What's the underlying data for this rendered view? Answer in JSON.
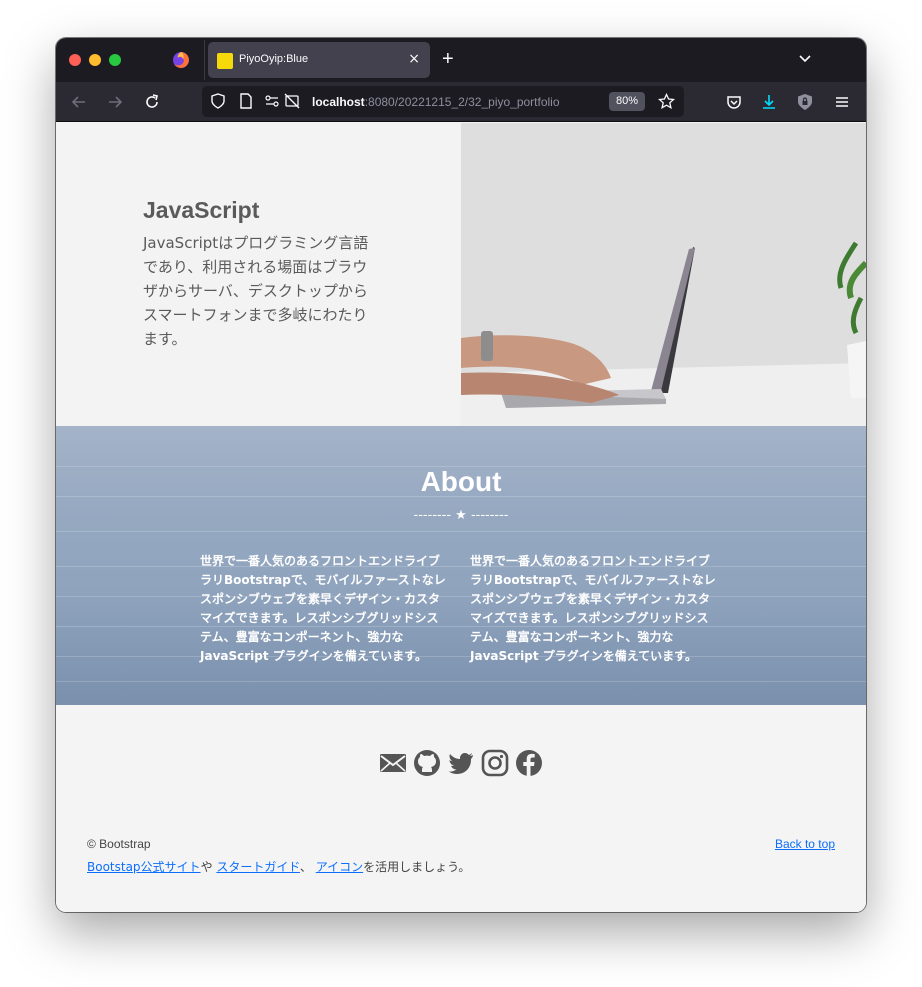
{
  "browser": {
    "tab_title": "PiyoOyip:Blue",
    "tab_close": "×",
    "new_tab": "+",
    "url_host": "localhost",
    "url_rest": ":8080/20221215_2/32_piyo_portfolio",
    "zoom": "80%"
  },
  "hero": {
    "title": "JavaScript",
    "description": "JavaScriptはプログラミング言語であり、利用される場面はブラウザからサーバ、デスクトップからスマートフォンまで多岐にわたります。"
  },
  "about": {
    "title": "About",
    "divider": "-------- ★ --------",
    "col_left": "世界で一番人気のあるフロントエンドライブラリBootstrapで、モバイルファーストなレスポンシブウェブを素早くデザイン・カスタマイズできます。レスポンシブグリッドシステム、豊富なコンポーネント、強力な JavaScript プラグインを備えています。",
    "col_right": "世界で一番人気のあるフロントエンドライブラリBootstrapで、モバイルファーストなレスポンシブウェブを素早くデザイン・カスタマイズできます。レスポンシブグリッドシステム、豊富なコンポーネント、強力な JavaScript プラグインを備えています。"
  },
  "footer": {
    "social_icons": [
      "envelope-icon",
      "github-icon",
      "twitter-icon",
      "instagram-icon",
      "facebook-icon"
    ],
    "copyright": "© Bootstrap",
    "link_official": "Bootstap公式サイト",
    "text_ya": "や ",
    "link_start": "スタートガイド",
    "text_comma": "、 ",
    "link_icons": "アイコン",
    "text_end": "を活用しましょう。",
    "back_to_top": "Back to top"
  },
  "colors": {
    "accent_link": "#0d6efd",
    "about_bg": "#96a9c1",
    "chrome_dark": "#1c1b22"
  }
}
